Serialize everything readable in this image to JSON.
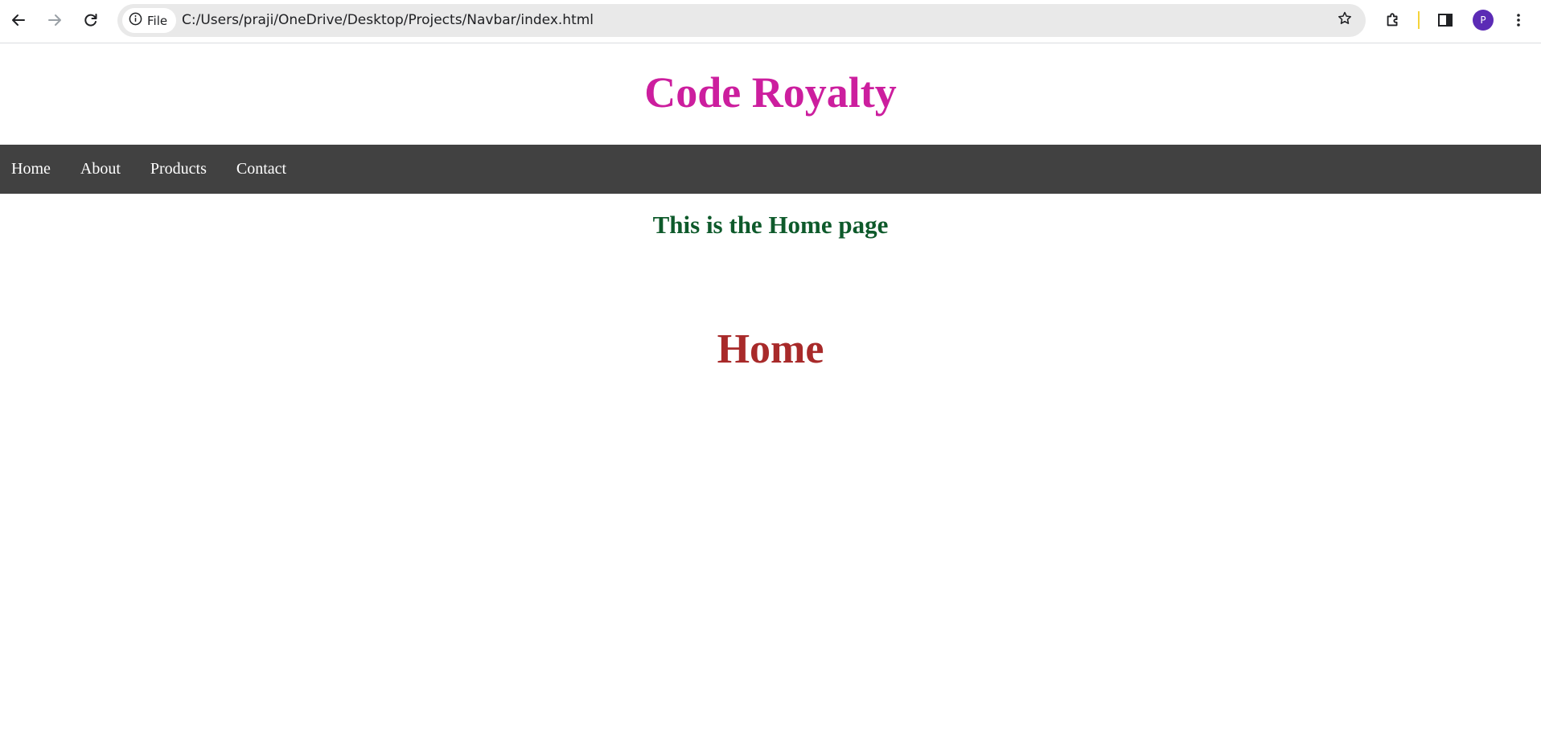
{
  "browser": {
    "site_chip_label": "File",
    "url": "C:/Users/praji/OneDrive/Desktop/Projects/Navbar/index.html",
    "profile_initial": "P",
    "icons": {
      "back": "back-arrow-icon",
      "forward": "forward-arrow-icon",
      "reload": "reload-icon",
      "info": "info-icon",
      "bookmark": "star-icon",
      "extensions": "puzzle-icon",
      "side_panel": "side-panel-icon",
      "menu": "kebab-menu-icon"
    }
  },
  "page": {
    "brand_title": "Code Royalty",
    "nav": {
      "items": [
        {
          "label": "Home"
        },
        {
          "label": "About"
        },
        {
          "label": "Products"
        },
        {
          "label": "Contact"
        }
      ]
    },
    "subtitle": "This is the Home page",
    "section_heading": "Home"
  },
  "colors": {
    "brand": "#cc1e9e",
    "navbar_bg": "#414141",
    "subtitle": "#0e5a2b",
    "section_heading": "#a82a2a",
    "avatar": "#5b2bb5"
  }
}
